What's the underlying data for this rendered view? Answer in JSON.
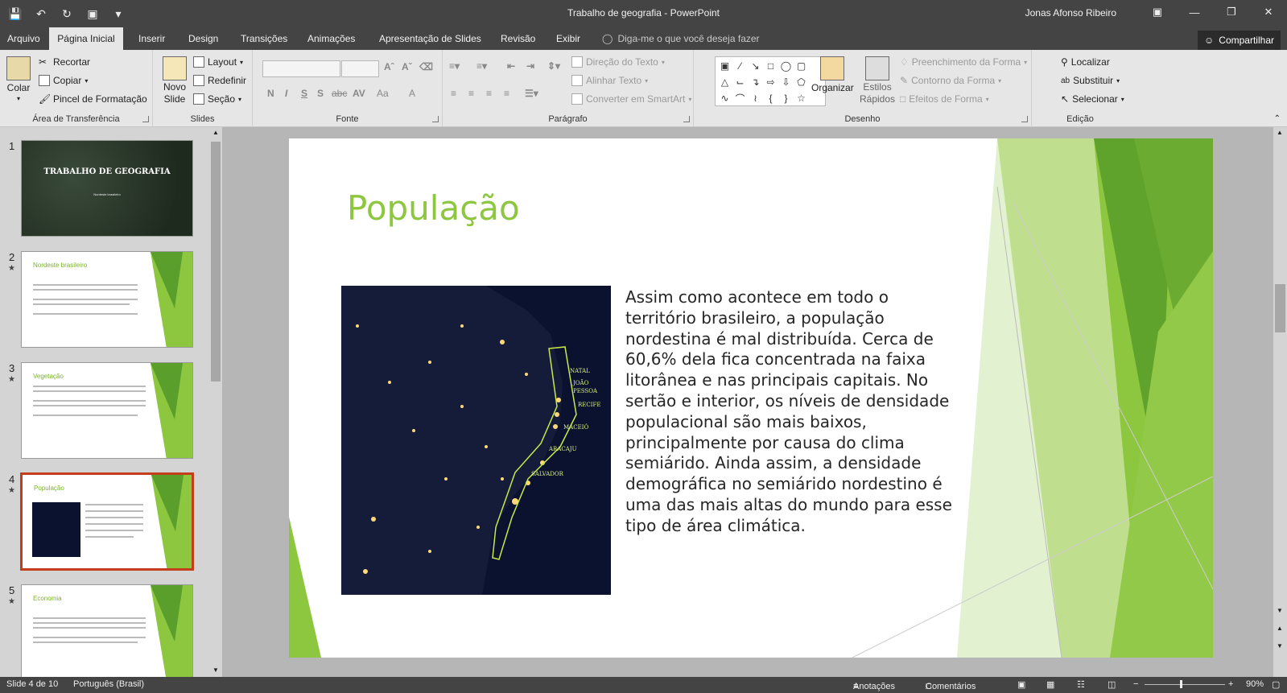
{
  "window": {
    "title": "Trabalho de geografia - PowerPoint",
    "user": "Jonas Afonso Ribeiro"
  },
  "tabs": {
    "items": [
      "Arquivo",
      "Página Inicial",
      "Inserir",
      "Design",
      "Transições",
      "Animações",
      "Apresentação de Slides",
      "Revisão",
      "Exibir"
    ],
    "tell_me": "Diga-me o que você deseja fazer",
    "share": "Compartilhar"
  },
  "ribbon": {
    "clipboard": {
      "paste": "Colar",
      "cut": "Recortar",
      "copy": "Copiar",
      "format_painter": "Pincel de Formatação",
      "label": "Área de Transferência"
    },
    "slides": {
      "new_slide": "Novo",
      "new_slide2": "Slide",
      "layout": "Layout",
      "reset": "Redefinir",
      "section": "Seção",
      "label": "Slides"
    },
    "font": {
      "label": "Fonte",
      "bold": "N",
      "italic": "I",
      "underline": "S",
      "shadow": "S",
      "strike": "abc",
      "spacing": "AV",
      "case": "Aa",
      "color": "A"
    },
    "paragraph": {
      "text_direction": "Direção do Texto",
      "align_text": "Alinhar Texto",
      "smartart": "Converter em SmartArt",
      "label": "Parágrafo"
    },
    "drawing": {
      "arrange": "Organizar",
      "quick_styles": "Estilos",
      "quick_styles2": "Rápidos",
      "fill": "Preenchimento da Forma",
      "outline": "Contorno da Forma",
      "effects": "Efeitos de Forma",
      "label": "Desenho"
    },
    "editing": {
      "find": "Localizar",
      "replace": "Substituir",
      "select": "Selecionar",
      "label": "Edição"
    }
  },
  "thumbnails": [
    {
      "num": "1",
      "title": "TRABALHO DE GEOGRAFIA",
      "subtitle": "Nordeste brasileiro"
    },
    {
      "num": "2",
      "title": "Nordeste brasileiro"
    },
    {
      "num": "3",
      "title": "Vegetação"
    },
    {
      "num": "4",
      "title": "População"
    },
    {
      "num": "5",
      "title": "Economia"
    }
  ],
  "slide": {
    "title": "População",
    "map_labels": [
      "NATAL",
      "JOÃO",
      "PESSOA",
      "RECIFE",
      "MACEIÓ",
      "ARACAJU",
      "SALVADOR"
    ],
    "body": "Assim como acontece em todo o território brasileiro, a população nordestina é mal distribuída. Cerca de 60,6% dela fica concentrada na faixa litorânea e nas principais capitais. No sertão e interior, os níveis de densidade populacional são mais baixos, principalmente por causa do clima semiárido. Ainda assim, a densidade demográfica no semiárido nordestino é uma das mais altas do mundo para esse tipo de área climática."
  },
  "status": {
    "slide_info": "Slide 4 de 10",
    "language": "Português (Brasil)",
    "notes": "Anotações",
    "comments": "Comentários",
    "zoom": "90%"
  }
}
